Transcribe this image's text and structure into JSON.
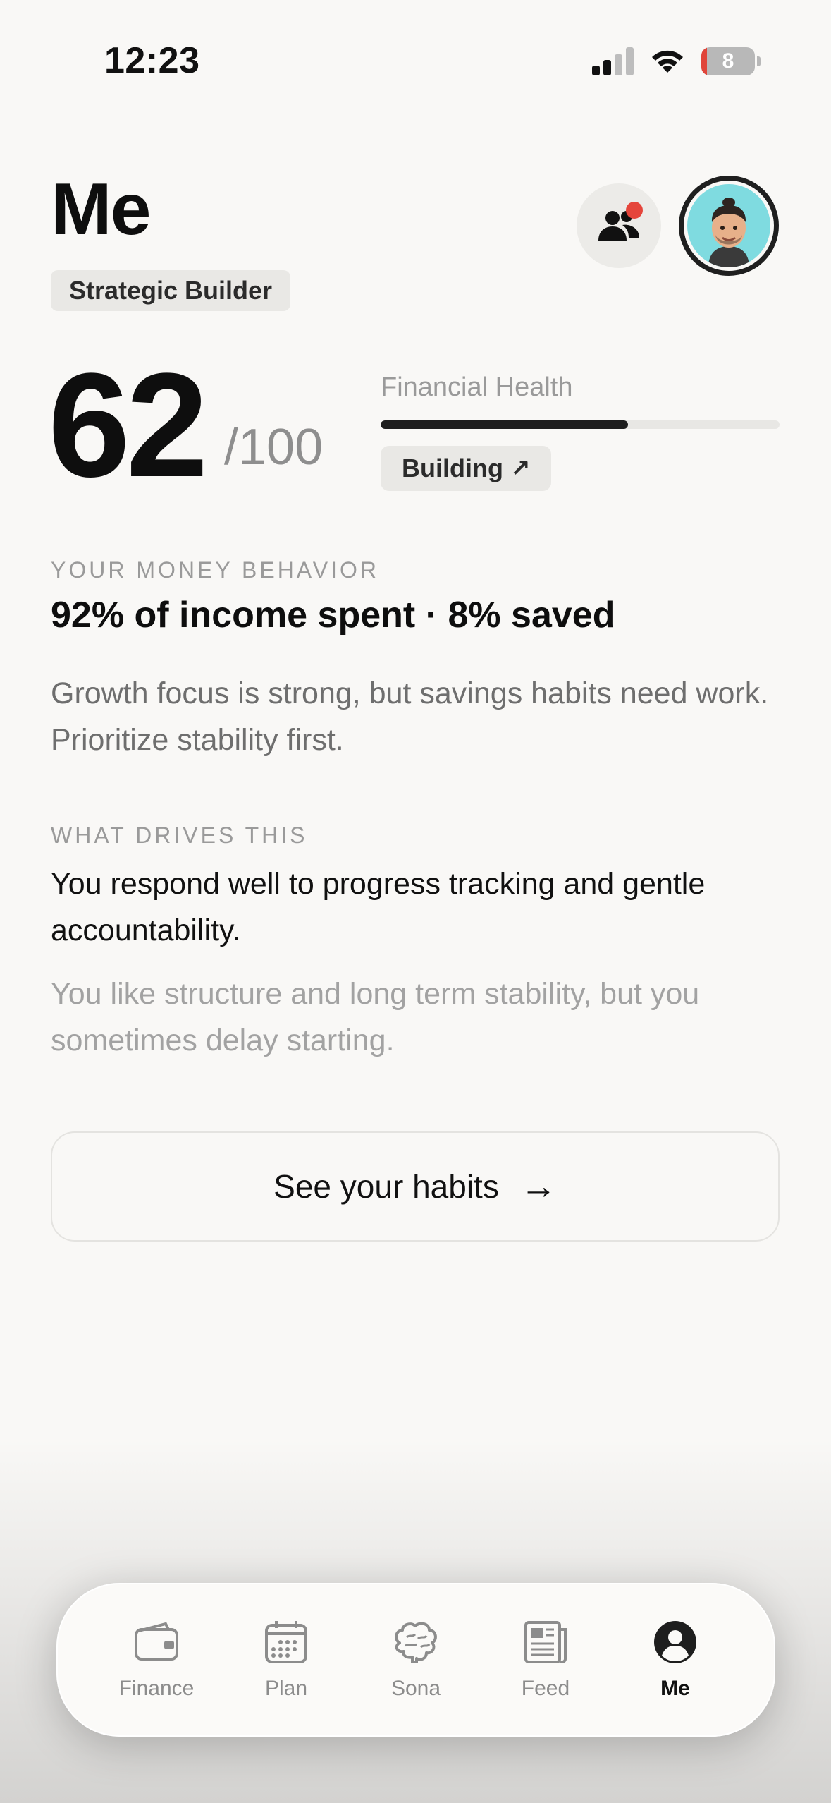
{
  "status_bar": {
    "time": "12:23",
    "battery_level": "8",
    "signal_bars": 2
  },
  "header": {
    "title": "Me",
    "archetype": "Strategic Builder",
    "friends_notification": true
  },
  "score": {
    "value": "62",
    "max": "/100",
    "label": "Financial Health",
    "progress": 0.62,
    "status": "Building",
    "status_icon": "↗"
  },
  "money_behavior": {
    "eyebrow": "YOUR MONEY BEHAVIOR",
    "headline": "92% of income spent · 8% saved",
    "description": "Growth focus is strong, but savings habits need work. Prioritize stability first."
  },
  "drivers": {
    "eyebrow": "WHAT DRIVES THIS",
    "primary": "You respond well to progress tracking and gentle accountability.",
    "secondary": "You like structure and long term stability, but you sometimes delay starting."
  },
  "cta": {
    "label": "See your habits",
    "icon": "→"
  },
  "tabs": [
    {
      "label": "Finance",
      "icon": "wallet-icon",
      "active": false
    },
    {
      "label": "Plan",
      "icon": "calendar-icon",
      "active": false
    },
    {
      "label": "Sona",
      "icon": "brain-icon",
      "active": false
    },
    {
      "label": "Feed",
      "icon": "newspaper-icon",
      "active": false
    },
    {
      "label": "Me",
      "icon": "profile-icon",
      "active": true
    }
  ],
  "colors": {
    "background": "#F9F8F6",
    "accent_dark": "#1E1E1E",
    "notification": "#E5453B",
    "avatar_bg": "#7FDBE0"
  }
}
